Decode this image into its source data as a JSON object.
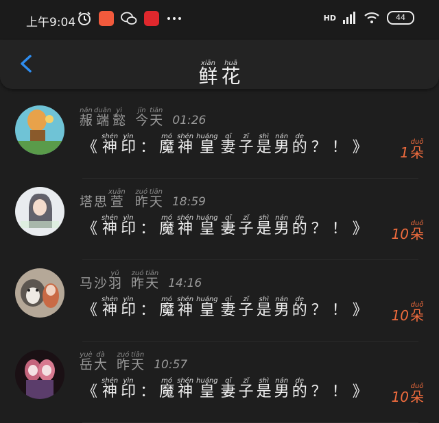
{
  "status_bar": {
    "time": "上午9:04",
    "network_label": "HD",
    "battery": "44",
    "icons": [
      "alarm-icon",
      "orange-app-icon",
      "wechat-icon",
      "red-app-icon",
      "more-icon",
      "signal-icon",
      "wifi-icon",
      "battery-icon"
    ]
  },
  "header": {
    "back_icon": "chevron-left-icon",
    "title": [
      {
        "py": "xiān",
        "hz": "鲜"
      },
      {
        "py": "huā",
        "hz": "花"
      }
    ]
  },
  "list": [
    {
      "name": [
        {
          "py": "nǎn",
          "hz": "赧"
        },
        {
          "py": "duān",
          "hz": "端"
        },
        {
          "py": "yì",
          "hz": "懿"
        }
      ],
      "day": [
        {
          "py": "jīn",
          "hz": "今"
        },
        {
          "py": "tiān",
          "hz": "天"
        }
      ],
      "time": "01:26",
      "count": "1",
      "avatar": "balloon"
    },
    {
      "name": [
        {
          "py": "",
          "hz": "塔"
        },
        {
          "py": "",
          "hz": "思"
        },
        {
          "py": "xuān",
          "hz": "萱"
        }
      ],
      "day": [
        {
          "py": "zuó",
          "hz": "昨"
        },
        {
          "py": "tiān",
          "hz": "天"
        }
      ],
      "time": "18:59",
      "count": "10",
      "avatar": "girl"
    },
    {
      "name": [
        {
          "py": "",
          "hz": "马"
        },
        {
          "py": "",
          "hz": "沙"
        },
        {
          "py": "yǔ",
          "hz": "羽"
        }
      ],
      "day": [
        {
          "py": "zuó",
          "hz": "昨"
        },
        {
          "py": "tiān",
          "hz": "天"
        }
      ],
      "time": "14:16",
      "count": "10",
      "avatar": "dog"
    },
    {
      "name": [
        {
          "py": "yuè",
          "hz": "岳"
        },
        {
          "py": "dà",
          "hz": "大"
        }
      ],
      "day": [
        {
          "py": "zuó",
          "hz": "昨"
        },
        {
          "py": "tiān",
          "hz": "天"
        }
      ],
      "time": "10:57",
      "count": "10",
      "avatar": "anime"
    }
  ],
  "message": {
    "open": "《",
    "close": "》",
    "colon": "：",
    "q": "？",
    "ex": "！",
    "part1": [
      {
        "py": "shén",
        "hz": "神"
      },
      {
        "py": "yìn",
        "hz": "印"
      }
    ],
    "part2": [
      {
        "py": "mó",
        "hz": "魔"
      },
      {
        "py": "shén",
        "hz": "神"
      },
      {
        "py": "huáng",
        "hz": "皇"
      },
      {
        "py": "qī",
        "hz": "妻"
      },
      {
        "py": "zǐ",
        "hz": "子"
      },
      {
        "py": "shì",
        "hz": "是"
      },
      {
        "py": "nán",
        "hz": "男"
      },
      {
        "py": "de",
        "hz": "的"
      }
    ]
  },
  "count_unit": {
    "py": "duǒ",
    "hz": "朵"
  }
}
